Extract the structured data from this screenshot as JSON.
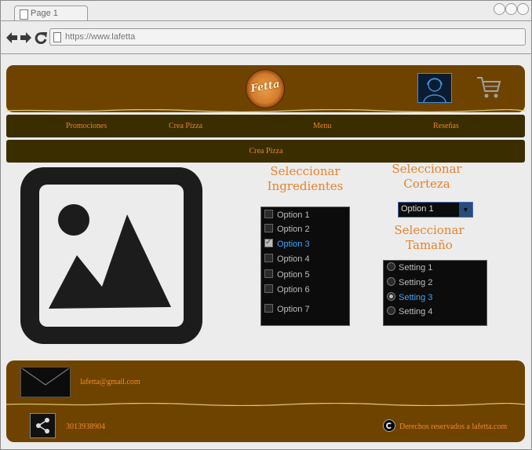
{
  "browser": {
    "tab_title": "Page 1",
    "url": "https://www.lafetta"
  },
  "header": {
    "logo_text": "Fetta",
    "icons": {
      "logo": "pizza-logo",
      "user": "user-avatar-icon",
      "cart": "shopping-cart-icon"
    }
  },
  "nav": {
    "items": [
      "Promociones",
      "Crea Pizza",
      "Menu",
      "Reseñas"
    ]
  },
  "subnav": {
    "label": "Crea Pizza"
  },
  "builder": {
    "image_icon": "image-placeholder-icon",
    "ingredients": {
      "heading": "Seleccionar\nIngredientes",
      "options": [
        "Option 1",
        "Option 2",
        "Option 3",
        "Option 4",
        "Option 5",
        "Option 6",
        "Option 7"
      ],
      "checked": "Option 3"
    },
    "crust": {
      "heading": "Seleccionar\nCorteza",
      "selected": "Option 1"
    },
    "size": {
      "heading": "Seleccionar\nTamaño",
      "options": [
        "Setting 1",
        "Setting 2",
        "Setting 3",
        "Setting 4"
      ],
      "selected": "Setting 3"
    }
  },
  "footer": {
    "email": "lafetta@gmail.com",
    "phone": "3013938904",
    "copyright": "Derechos reservados a lafetta.com",
    "icons": {
      "mail": "mail-icon",
      "share": "share-icon",
      "copyright": "copyright-icon"
    }
  },
  "colors": {
    "brown": "#6e4300",
    "dark_olive": "#3a2e00",
    "accent_orange": "#e8822c",
    "selection_blue": "#3aa6ff"
  }
}
